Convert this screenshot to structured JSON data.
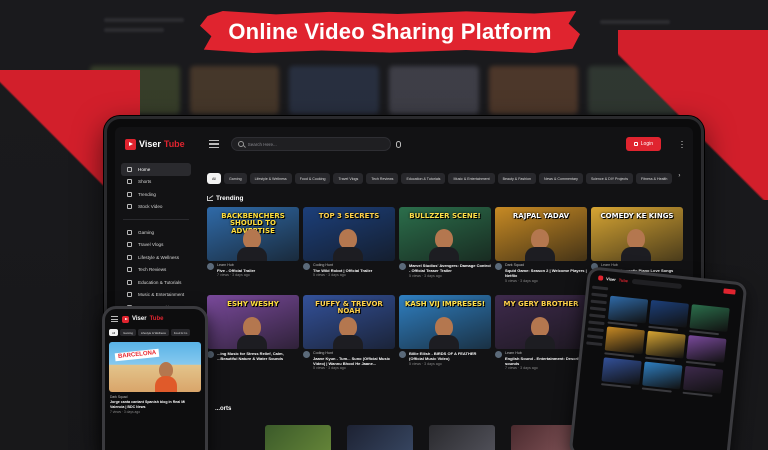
{
  "headline": "Online Video Sharing Platform",
  "app": {
    "logo_part1": "Viser",
    "logo_part2": "Tube",
    "search_placeholder": "Search Here...",
    "login_label": "Login"
  },
  "sidebar": {
    "primary": [
      {
        "label": "Home",
        "icon": "home-icon"
      },
      {
        "label": "Shorts",
        "icon": "shorts-icon"
      },
      {
        "label": "Trending",
        "icon": "trending-icon"
      },
      {
        "label": "Stock Video",
        "icon": "stock-video-icon"
      }
    ],
    "categories": [
      {
        "label": "Gaming",
        "icon": "gaming-icon"
      },
      {
        "label": "Travel Vlogs",
        "icon": "travel-icon"
      },
      {
        "label": "Lifestyle & Wellness",
        "icon": "lifestyle-icon"
      },
      {
        "label": "Tech Reviews",
        "icon": "tech-icon"
      },
      {
        "label": "Education & Tutorials",
        "icon": "education-icon"
      },
      {
        "label": "Music & Entertainment",
        "icon": "music-icon"
      },
      {
        "label": "Beauty & Fashion",
        "icon": "beauty-icon"
      }
    ]
  },
  "chips": [
    "All",
    "Gaming",
    "Lifestyle & Wellness",
    "Food & Cooking",
    "Travel Vlogs",
    "Tech Reviews",
    "Education & Tutorials",
    "Music & Entertainment",
    "Beauty & Fashion",
    "News & Commentary",
    "Science & DIY Projects",
    "Fitness & Health"
  ],
  "trending_title": "Trending",
  "videos": [
    {
      "thumb_text": "BACKBENCHERS SHOULD TO ADVERTISE",
      "channel": "Learn Hub",
      "title": "Five - Official Trailer",
      "stats": "7 views  ·  3 days ago",
      "bg": "#2f6aa8",
      "fg": "#ffde3b"
    },
    {
      "thumb_text": "TOP 3 SECRETS",
      "channel": "Coding Hunt",
      "title": "The Wild Robot | Official Trailer",
      "stats": "5 views  ·  3 days ago",
      "bg": "#1c3f7a",
      "fg": "#ffd24a"
    },
    {
      "thumb_text": "BULLZZER SCENE!",
      "channel": "",
      "title": "Marvel Studios' Avengers: Damage Control - Official Teaser Trailer",
      "stats": "5 views  ·  3 days ago",
      "bg": "#2b6e4b",
      "fg": "#ffe14a"
    },
    {
      "thumb_text": "RAJPAL YADAV",
      "channel": "Dark Squad",
      "title": "Squid Game: Season 2 | Welcome Players | Netflix",
      "stats": "5 views  ·  3 days ago",
      "bg": "#c78a24",
      "fg": "#fff"
    },
    {
      "thumb_text": "COMEDY KE KINGS",
      "channel": "Learn Hub",
      "title": "Beautiful Romantic Piano Love Songs Melodies - Great Relaxing Piano Instrumental Love Songs Ever",
      "stats": "7 views  ·  2 days ago",
      "bg": "#d7a533",
      "fg": "#fff"
    },
    {
      "thumb_text": "ESHY WESHY",
      "channel": "",
      "title": "...ing Music for Stress Relief, Calm, ...Beautiful Nature & Water Sounds",
      "stats": "",
      "bg": "#7a4a9c",
      "fg": "#ffde3b"
    },
    {
      "thumb_text": "FUFFY & TREVOR NOAH",
      "channel": "Coding Hunt",
      "title": "Jaane Kyun - Tum... Suno (Official Music Video) | Wannu Bhool He Jaane...",
      "stats": "5 views  ·  3 days ago",
      "bg": "#33519a",
      "fg": "#ffd24a"
    },
    {
      "thumb_text": "KASH VIJ IMPRESES!",
      "channel": "",
      "title": "Billie Eilish - BIRDS OF A FEATHER (Official Music Video)",
      "stats": "5 views  ·  3 days ago",
      "bg": "#2f7fc1",
      "fg": "#ffe14a"
    },
    {
      "thumb_text": "MY GERY BROTHER",
      "channel": "Learn Hub",
      "title": "English Sound - Entertainment: Describing sounds",
      "stats": "7 views  ·  3 days ago",
      "bg": "#3e2a4c",
      "fg": "#ffd24a"
    }
  ],
  "shorts_title": "...orts",
  "phone": {
    "chips": [
      "All",
      "Gaming",
      "Lifestyle & Wellness",
      "Food & Co"
    ],
    "thumb_text": "BARCELONA",
    "channel": "Dark Squad",
    "title": "Jorge canta cantant Spanish blog in Real Mi Valencia | BDC News",
    "stats": "7 views  ·  3 days ago"
  },
  "colors": {
    "accent": "#e0242f",
    "background": "#121214"
  }
}
